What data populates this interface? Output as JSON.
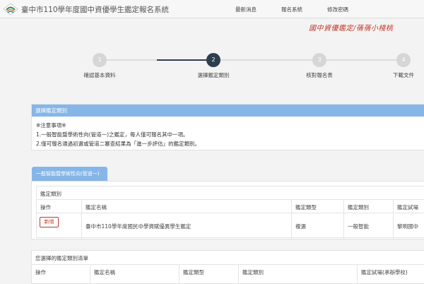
{
  "header": {
    "title": "臺中市110學年度國中資優學生鑑定報名系統",
    "nav": [
      "最新消息",
      "報名系統",
      "修改密碼"
    ]
  },
  "watermark": "國中資優鑑定/蒨蒨小棧桃",
  "steps": [
    {
      "number": "1",
      "label": "確認基本資料",
      "active": false
    },
    {
      "number": "2",
      "label": "選擇鑑定類別",
      "active": true
    },
    {
      "number": "3",
      "label": "核對報名表",
      "active": false
    },
    {
      "number": "4",
      "label": "下載文件",
      "active": false
    }
  ],
  "select_panel": {
    "title": "選擇鑑定類別",
    "notes_heading": "※注意事項※",
    "notes": [
      "1.一般智能暨學術性向(管道一)之鑑定，每人僅可報名其中一項。",
      "2.僅可報名通過初選或管道二審查結果為「進一步評估」的鑑定類別。"
    ]
  },
  "tab": {
    "label": "一般智能暨學術性向(管道一)"
  },
  "category_panel": {
    "title": "鑑定類別",
    "columns": [
      "操作",
      "鑑定名稱",
      "鑑定類型",
      "鑑定類別",
      "鑑定試場"
    ],
    "rows": [
      {
        "action": "新增",
        "name": "臺中市110學年度國民中學資賦優異學生鑑定",
        "type": "複選",
        "category": "一般智能",
        "venue": "黎明國中"
      }
    ]
  },
  "selected_panel": {
    "title": "您選擇的鑑定類別清單",
    "columns": [
      "操作",
      "鑑定名稱",
      "鑑定類型",
      "鑑定類別",
      "鑑定試場(承辦學校)"
    ]
  },
  "colors": {
    "accent": "#86b6e8",
    "step_active": "#2c3e50",
    "danger": "#c0392b"
  }
}
